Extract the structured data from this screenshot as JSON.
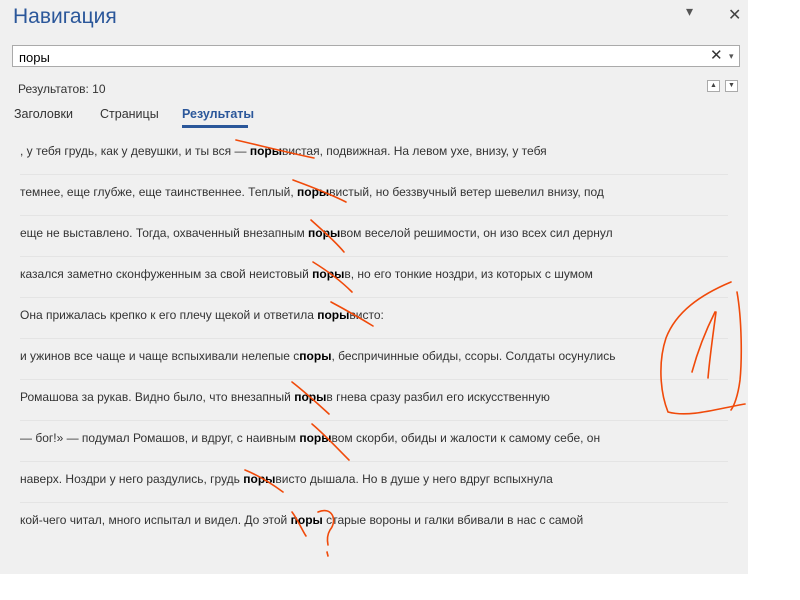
{
  "panel": {
    "title": "Навигация",
    "pin_icon": "▾",
    "close_icon": "✕"
  },
  "search": {
    "value": "поры",
    "clear_icon": "✕",
    "dropdown_icon": "▾"
  },
  "results_count": "Результатов: 10",
  "result_nav": {
    "prev_icon": "▲",
    "next_icon": "▼"
  },
  "tabs": [
    {
      "label": "Заголовки",
      "active": false
    },
    {
      "label": "Страницы",
      "active": false
    },
    {
      "label": "Результаты",
      "active": true
    }
  ],
  "results": [
    {
      "pre": ", у тебя грудь, как у девушки, и ты вся — ",
      "match": "поры",
      "post": "вистая, подвижная. На левом ухе, внизу, у тебя"
    },
    {
      "pre": "темнее, еще глубже, еще таинственнее. Теплый, ",
      "match": "поры",
      "post": "вистый, но беззвучный ветер шевелил внизу, под"
    },
    {
      "pre": "еще не выставлено. Тогда, охваченный внезапным ",
      "match": "поры",
      "post": "вом веселой решимости, он изо всех сил дернул"
    },
    {
      "pre": "казался заметно сконфуженным за свой неистовый ",
      "match": "поры",
      "post": "в, но его тонкие ноздри, из которых с шумом"
    },
    {
      "pre": "Она прижалась крепко к его плечу щекой и ответила ",
      "match": "поры",
      "post": "висто:"
    },
    {
      "pre": "и ужинов все чаще и чаще вспыхивали нелепые с",
      "match": "поры",
      "post": ", беспричинные обиды, ссоры. Солдаты осунулись"
    },
    {
      "pre": "Ромашова за рукав. Видно было, что внезапный ",
      "match": "поры",
      "post": "в гнева сразу разбил его искусственную"
    },
    {
      "pre": "— бог!» — подумал Ромашов, и вдруг, с наивным ",
      "match": "поры",
      "post": "вом скорби, обиды и жалости к самому себе, он"
    },
    {
      "pre": "наверх. Ноздри у него раздулись, грудь ",
      "match": "поры",
      "post": "висто дышала. Но в душе у него вдруг вспыхнула"
    },
    {
      "pre": "кой-чего читал, много испытал и видел. До этой ",
      "match": "поры",
      "post": " старые вороны и галки вбивали в нас с самой"
    }
  ],
  "annotation": {
    "color": "#f04a0a"
  }
}
